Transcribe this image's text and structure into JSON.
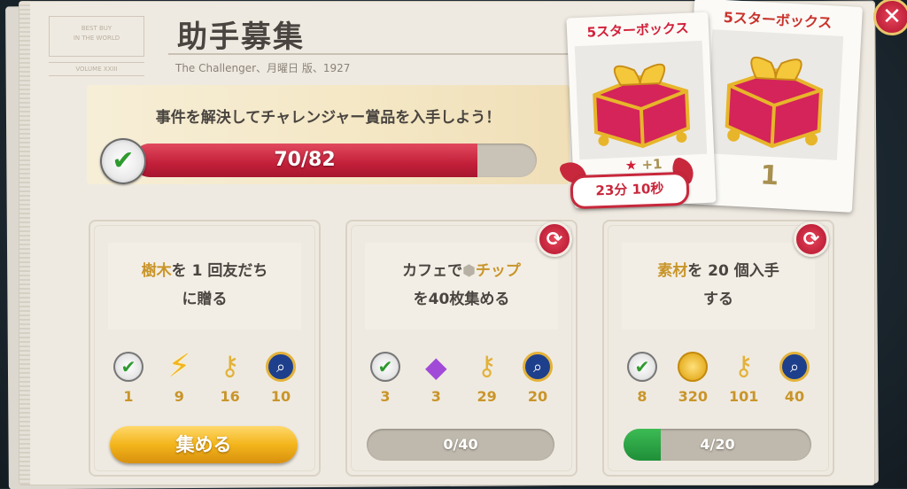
{
  "page": {
    "title": "助手募集",
    "subtitle": "The Challenger、月曜日 版、1927",
    "stamp_top": "BEST BUY\nIN THE WORLD",
    "stamp_bottom": "VOLUME XXIII"
  },
  "banner": {
    "headline": "事件を解決してチャレンジャー賞品を入手しよう！",
    "progress_text": "70/82",
    "progress_current": 70,
    "progress_total": 82,
    "check_icon": "check-badge-icon"
  },
  "rewards": {
    "card_front": {
      "label": "5スターボックス",
      "bonus": "+1",
      "timer": "23分 10秒"
    },
    "card_back": {
      "label": "5スターボックス",
      "count": "1"
    }
  },
  "close_button": {
    "icon": "close-icon",
    "glyph": "✕"
  },
  "tasks": [
    {
      "desc_line1_hl": "樹木",
      "desc_line1_rest": "を 1 回友だち",
      "desc_line2": "に贈る",
      "rewards": [
        {
          "icon": "check-badge-icon",
          "value": "1"
        },
        {
          "icon": "lightning-icon",
          "value": "9"
        },
        {
          "icon": "wind-up-key-icon",
          "value": "16"
        },
        {
          "icon": "magnifier-badge-icon",
          "value": "10"
        }
      ],
      "action": {
        "type": "button",
        "label": "集める"
      }
    },
    {
      "desc_line1_pre": "カフェで",
      "desc_line1_hl": "チップ",
      "desc_line2": "を40枚集める",
      "rewards": [
        {
          "icon": "check-badge-icon",
          "value": "3"
        },
        {
          "icon": "diamond-icon",
          "value": "3"
        },
        {
          "icon": "wind-up-key-icon",
          "value": "29"
        },
        {
          "icon": "magnifier-badge-icon",
          "value": "20"
        }
      ],
      "action": {
        "type": "progress",
        "text": "0/40",
        "fraction": 0.0
      }
    },
    {
      "desc_line1_hl": "素材",
      "desc_line1_rest": "を 20 個入手",
      "desc_line2": "する",
      "rewards": [
        {
          "icon": "check-badge-icon",
          "value": "8"
        },
        {
          "icon": "coin-icon",
          "value": "320"
        },
        {
          "icon": "wind-up-key-icon",
          "value": "101"
        },
        {
          "icon": "magnifier-badge-icon",
          "value": "40"
        }
      ],
      "action": {
        "type": "progress",
        "text": "4/20",
        "fraction": 0.2
      }
    }
  ],
  "colors": {
    "accent_red": "#c31f3a",
    "gold": "#c9952a",
    "progress_green": "#1f8f38",
    "button_gold": "#f3b51b"
  }
}
